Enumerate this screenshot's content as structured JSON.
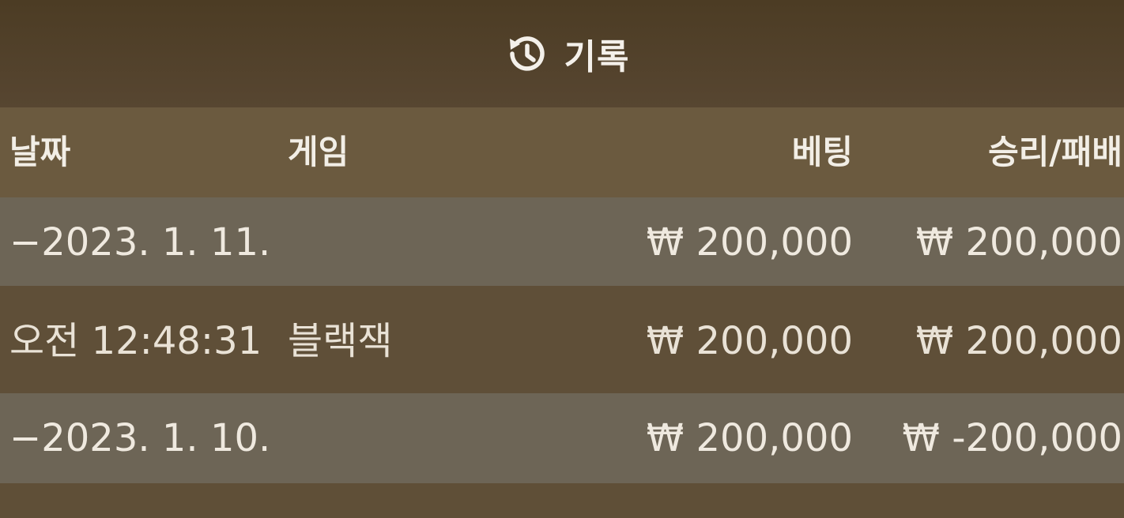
{
  "header": {
    "icon": "history-icon",
    "title": "기록"
  },
  "columns": {
    "date": "날짜",
    "game": "게임",
    "bet": "베팅",
    "win_loss": "승리/패배"
  },
  "rows": [
    {
      "date": "−2023. 1. 11.",
      "game": "",
      "bet": "₩ 200,000",
      "win_loss": "₩ 200,000"
    },
    {
      "date": "오전 12:48:31",
      "game": "블랙잭",
      "bet": "₩ 200,000",
      "win_loss": "₩ 200,000"
    },
    {
      "date": "−2023. 1. 10.",
      "game": "",
      "bet": "₩ 200,000",
      "win_loss": "₩ -200,000"
    }
  ],
  "colors": {
    "header_bg": "#4c3c24",
    "row_light": "#6d6556",
    "row_dark": "#5f4f38",
    "text": "#f1ece4"
  }
}
